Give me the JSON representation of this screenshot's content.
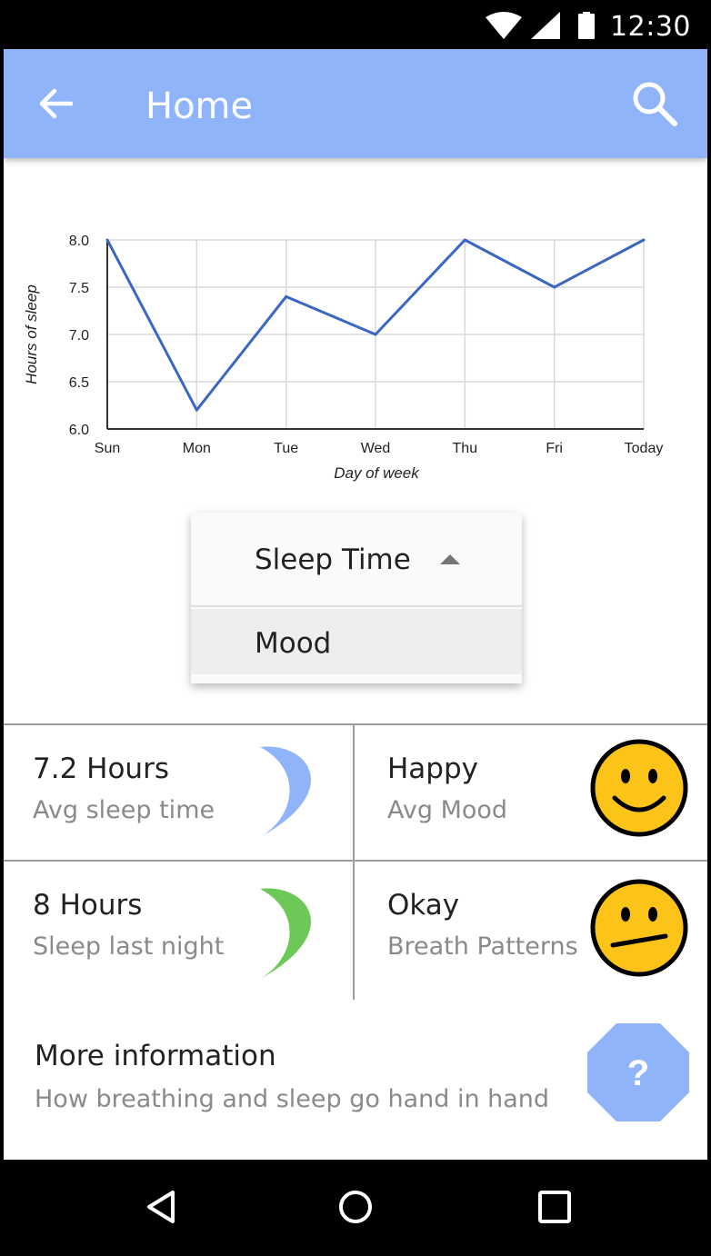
{
  "status_bar": {
    "time": "12:30"
  },
  "app_bar": {
    "title": "Home"
  },
  "chart_data": {
    "type": "line",
    "categories": [
      "Sun",
      "Mon",
      "Tue",
      "Wed",
      "Thu",
      "Fri",
      "Today"
    ],
    "values": [
      8.0,
      6.2,
      7.4,
      7.0,
      8.0,
      7.5,
      8.0
    ],
    "xlabel": "Day of week",
    "ylabel": "Hours of sleep",
    "ylim": [
      6.0,
      8.0
    ],
    "yticks": [
      "6.0",
      "6.5",
      "7.0",
      "7.5",
      "8.0"
    ],
    "grid": true,
    "line_color": "#3a66c4"
  },
  "dropdown": {
    "selected": "Sleep Time",
    "options": [
      "Mood"
    ]
  },
  "stats": [
    {
      "value": "7.2 Hours",
      "caption": "Avg sleep time",
      "icon": "moon-icon",
      "color": "#8fb4fa"
    },
    {
      "value": "Happy",
      "caption": "Avg Mood",
      "icon": "happy-face-icon",
      "color": "#fcc419"
    },
    {
      "value": "8 Hours",
      "caption": "Sleep last night",
      "icon": "moon-icon",
      "color": "#6cc957"
    },
    {
      "value": "Okay",
      "caption": "Breath Patterns",
      "icon": "neutral-face-icon",
      "color": "#fcc419"
    }
  ],
  "more_info": {
    "title": "More information",
    "subtitle": "How breathing and sleep go hand in hand",
    "help_glyph": "?"
  },
  "colors": {
    "accent": "#8fb4fa",
    "green": "#6cc957"
  }
}
